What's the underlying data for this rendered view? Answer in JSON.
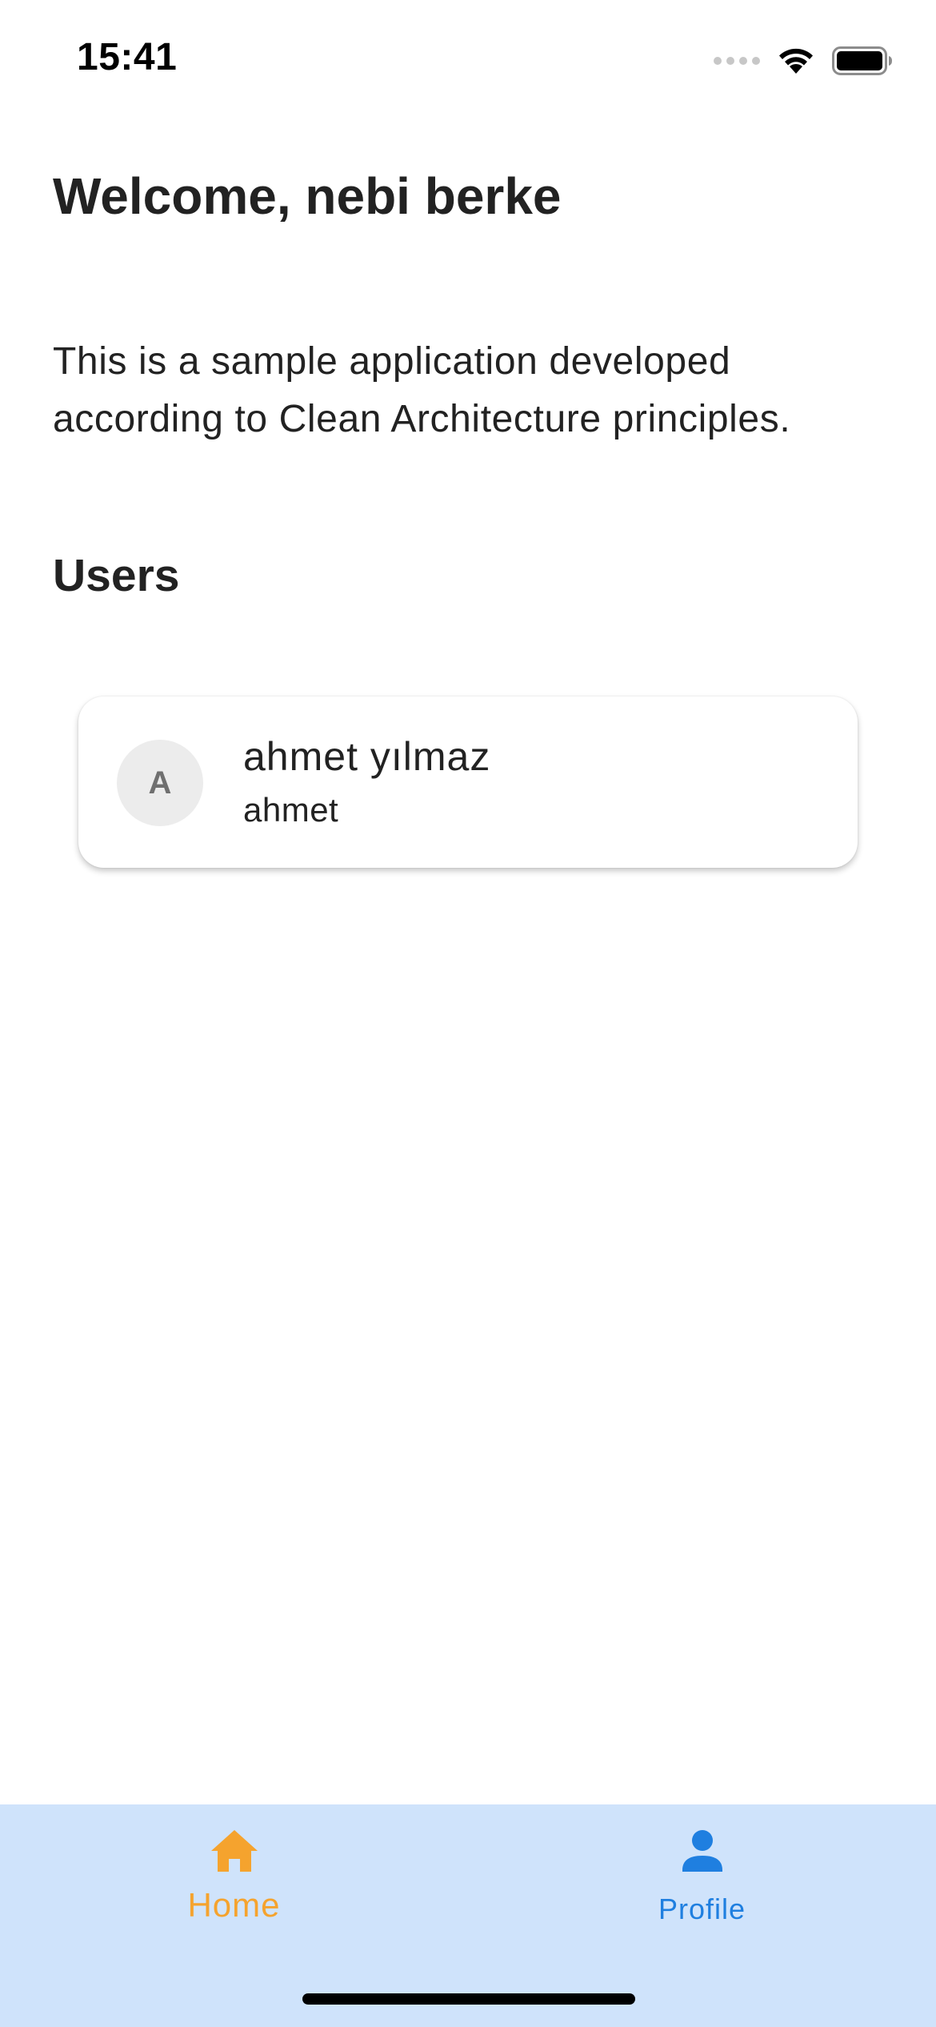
{
  "status_bar": {
    "time": "15:41",
    "icons": [
      "cellular-signal-icon",
      "wifi-icon",
      "battery-icon"
    ]
  },
  "home": {
    "welcome": "Welcome, nebi berke",
    "description": "This is a sample application developed according to Clean Architecture principles.",
    "section_title": "Users"
  },
  "users": [
    {
      "initial": "A",
      "name": "ahmet yılmaz",
      "username": "ahmet"
    }
  ],
  "bottom_nav": {
    "items": [
      {
        "label": "Home",
        "icon": "home-icon",
        "active": true,
        "color": "#f5a32e"
      },
      {
        "label": "Profile",
        "icon": "person-icon",
        "active": false,
        "color": "#1f7fe0"
      }
    ],
    "background": "#cfe3fb"
  }
}
